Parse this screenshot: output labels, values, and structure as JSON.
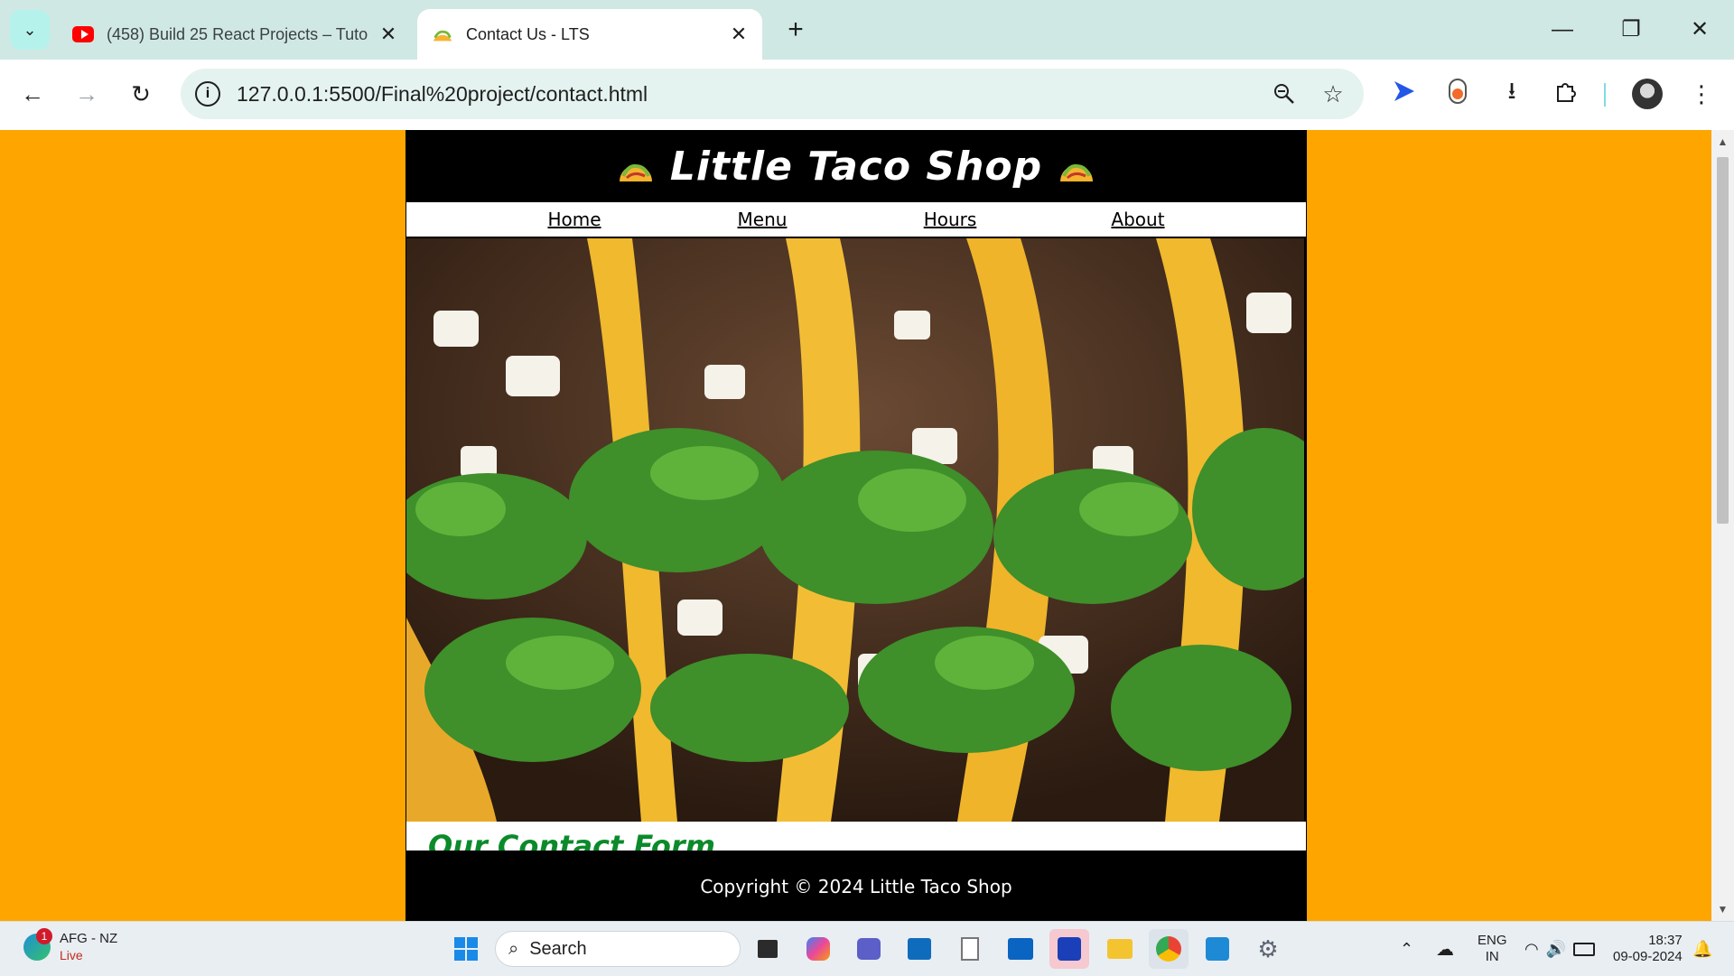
{
  "tabs": [
    {
      "title": "(458) Build 25 React Projects – Tuto",
      "favicon": "youtube-icon",
      "active": false
    },
    {
      "title": "Contact Us - LTS",
      "favicon": "taco-icon",
      "active": true
    }
  ],
  "address_bar": {
    "url": "127.0.0.1:5500/Final%20project/contact.html"
  },
  "site": {
    "title": "Little Taco Shop",
    "nav": [
      "Home",
      "Menu",
      "Hours",
      "About"
    ],
    "hero_alt": "tacos photo",
    "section_heading": "Our Contact Form",
    "footer": "Copyright © 2024 Little Taco Shop",
    "colors": {
      "page_bg": "#ffa500",
      "header_bg": "#000000",
      "heading_green": "#0b8a2a"
    }
  },
  "taskbar": {
    "news_badge": "1",
    "news_title": "AFG - NZ",
    "news_status": "Live",
    "search_label": "Search",
    "lang_line1": "ENG",
    "lang_line2": "IN",
    "time": "18:37",
    "date": "09-09-2024"
  }
}
